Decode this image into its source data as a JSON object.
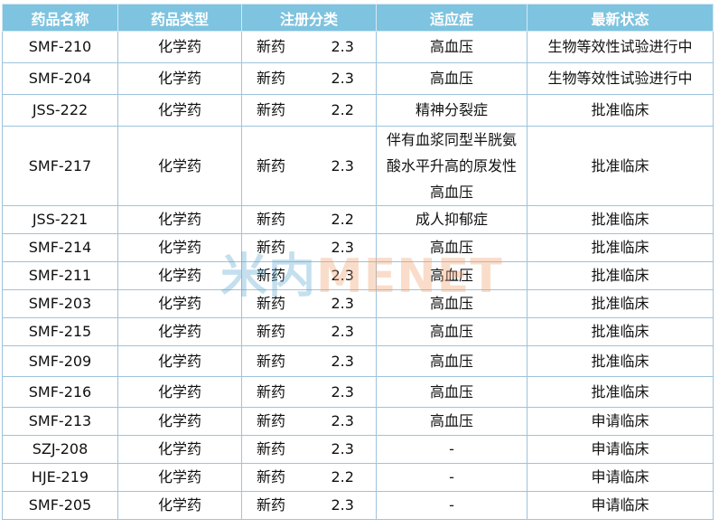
{
  "header": {
    "name": "药品名称",
    "type": "药品类型",
    "registration": "注册分类",
    "indication": "适应症",
    "status": "最新状态"
  },
  "rows": [
    {
      "name": "SMF-210",
      "type": "化学药",
      "reg_type": "新药",
      "reg_class": "2.3",
      "indication": "高血压",
      "status": "生物等效性试验进行中"
    },
    {
      "name": "SMF-204",
      "type": "化学药",
      "reg_type": "新药",
      "reg_class": "2.3",
      "indication": "高血压",
      "status": "生物等效性试验进行中"
    },
    {
      "name": "JSS-222",
      "type": "化学药",
      "reg_type": "新药",
      "reg_class": "2.2",
      "indication": "精神分裂症",
      "status": "批准临床"
    },
    {
      "name": "SMF-217",
      "type": "化学药",
      "reg_type": "新药",
      "reg_class": "2.3",
      "indication": "伴有血浆同型半胱氨酸水平升高的原发性高血压",
      "status": "批准临床"
    },
    {
      "name": "JSS-221",
      "type": "化学药",
      "reg_type": "新药",
      "reg_class": "2.2",
      "indication": "成人抑郁症",
      "status": "批准临床"
    },
    {
      "name": "SMF-214",
      "type": "化学药",
      "reg_type": "新药",
      "reg_class": "2.3",
      "indication": "高血压",
      "status": "批准临床"
    },
    {
      "name": "SMF-211",
      "type": "化学药",
      "reg_type": "新药",
      "reg_class": "2.3",
      "indication": "高血压",
      "status": "批准临床"
    },
    {
      "name": "SMF-203",
      "type": "化学药",
      "reg_type": "新药",
      "reg_class": "2.3",
      "indication": "高血压",
      "status": "批准临床"
    },
    {
      "name": "SMF-215",
      "type": "化学药",
      "reg_type": "新药",
      "reg_class": "2.3",
      "indication": "高血压",
      "status": "批准临床"
    },
    {
      "name": "SMF-209",
      "type": "化学药",
      "reg_type": "新药",
      "reg_class": "2.3",
      "indication": "高血压",
      "status": "批准临床"
    },
    {
      "name": "SMF-216",
      "type": "化学药",
      "reg_type": "新药",
      "reg_class": "2.3",
      "indication": "高血压",
      "status": "批准临床"
    },
    {
      "name": "SMF-213",
      "type": "化学药",
      "reg_type": "新药",
      "reg_class": "2.3",
      "indication": "高血压",
      "status": "申请临床"
    },
    {
      "name": "SZJ-208",
      "type": "化学药",
      "reg_type": "新药",
      "reg_class": "2.3",
      "indication": "-",
      "status": "申请临床"
    },
    {
      "name": "HJE-219",
      "type": "化学药",
      "reg_type": "新药",
      "reg_class": "2.2",
      "indication": "-",
      "status": "申请临床"
    },
    {
      "name": "SMF-205",
      "type": "化学药",
      "reg_type": "新药",
      "reg_class": "2.3",
      "indication": "-",
      "status": "申请临床"
    }
  ],
  "watermark": {
    "cn": "米内",
    "en": "MENET"
  },
  "colors": {
    "header_bg": "#7ec3df",
    "border": "#9ec3dd",
    "watermark_cn": "#5aa6cf",
    "watermark_en": "#f0a06a"
  }
}
